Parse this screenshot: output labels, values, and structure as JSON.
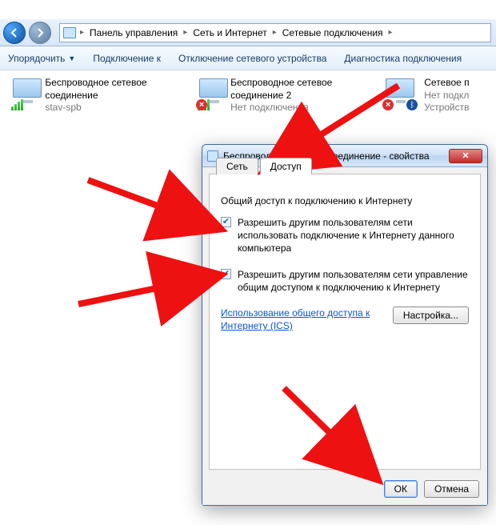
{
  "breadcrumb": {
    "items": [
      "Панель управления",
      "Сеть и Интернет",
      "Сетевые подключения"
    ]
  },
  "toolbar": {
    "organize": "Упорядочить",
    "connect": "Подключение к",
    "disable": "Отключение сетевого устройства",
    "diagnose": "Диагностика подключения"
  },
  "connections": [
    {
      "name": "Беспроводное сетевое соединение",
      "line2": "",
      "status": "stav-spb",
      "red_x": false,
      "bt": false
    },
    {
      "name": "Беспроводное сетевое соединение 2",
      "line2": "",
      "status": "Нет подключения",
      "red_x": true,
      "bt": false
    },
    {
      "name": "Сетевое п",
      "line2": "Нет подкл",
      "status": "Устройств",
      "red_x": true,
      "bt": true
    }
  ],
  "dialog": {
    "title": "Беспроводное сетевое соединение - свойства",
    "tab_network": "Сеть",
    "tab_sharing": "Доступ",
    "section": "Общий доступ к подключению к Интернету",
    "chk1": "Разрешить другим пользователям сети использовать подключение к Интернету данного компьютера",
    "chk2": "Разрешить другим пользователям сети управление общим доступом к подключению к Интернету",
    "link": "Использование общего доступа к Интернету (ICS)",
    "settings_btn": "Настройка...",
    "ok": "ОК",
    "cancel": "Отмена"
  }
}
